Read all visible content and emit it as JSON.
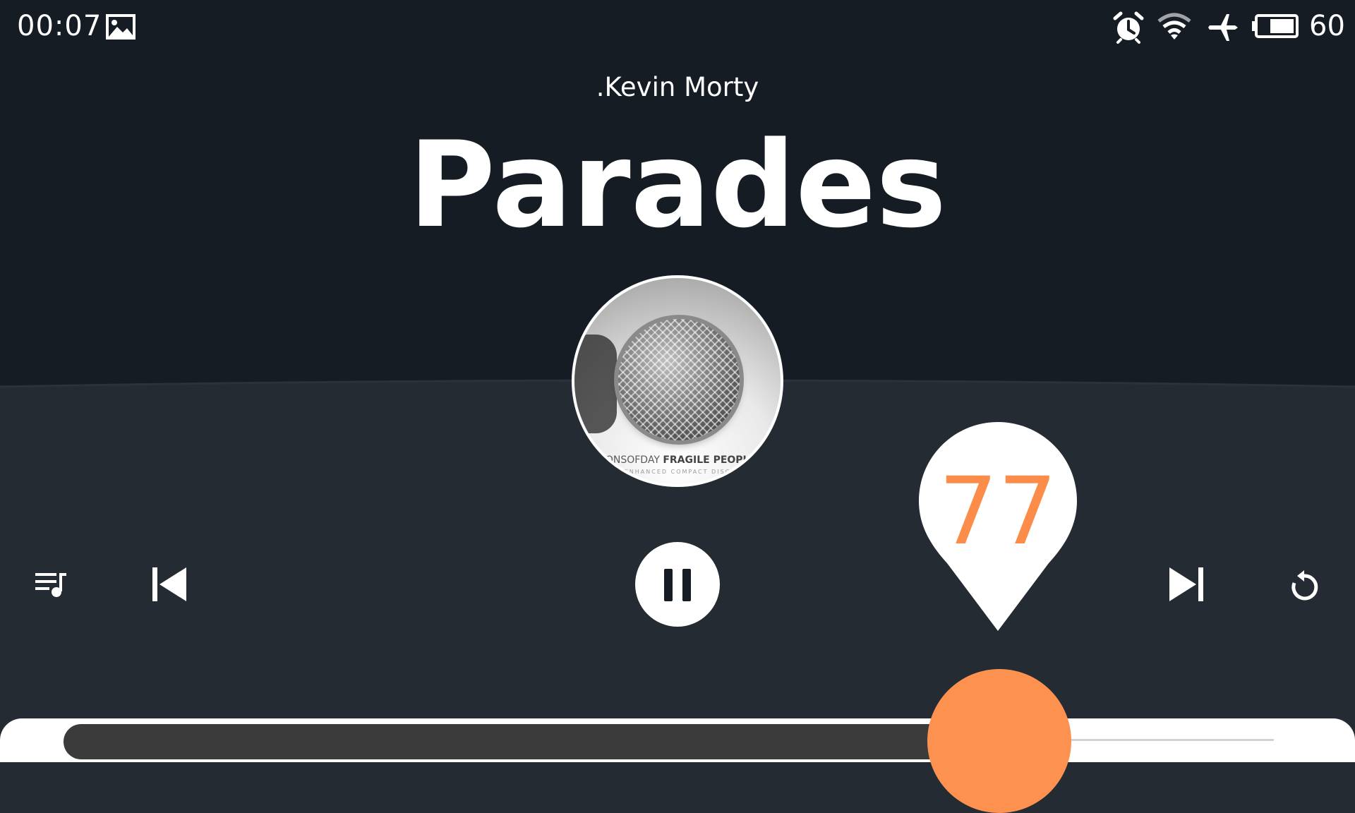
{
  "status_bar": {
    "time": "00:07",
    "battery": "60",
    "icons": [
      "gallery-icon",
      "alarm-icon",
      "wifi-icon",
      "airplane-icon",
      "battery-icon"
    ]
  },
  "now_playing": {
    "artist": ".Kevin Morty",
    "title": "Parades",
    "album_art": {
      "caption_artist": "SONSOFDAY",
      "caption_album": "FRAGILE PEOPLE",
      "caption_sub": "ENHANCED COMPACT DISC"
    }
  },
  "controls": {
    "icons": [
      "playlist-icon",
      "previous-icon",
      "pause-icon",
      "next-icon",
      "repeat-icon"
    ]
  },
  "progress": {
    "value": "77",
    "fraction": 0.77
  },
  "colors": {
    "top_background": "#161c24",
    "bottom_background": "#252b33",
    "accent": "#fd9150"
  }
}
